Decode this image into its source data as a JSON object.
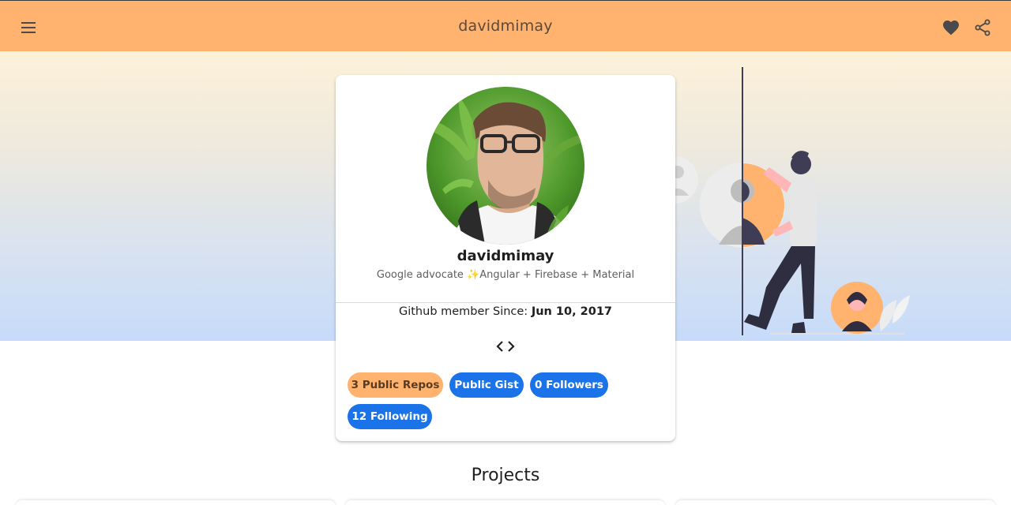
{
  "toolbar": {
    "title": "davidmimay",
    "menu_icon": "menu-icon",
    "favorite_icon": "heart-icon",
    "share_icon": "share-icon"
  },
  "profile": {
    "username": "davidmimay",
    "bio": "Google advocate ✨Angular + Firebase + Material",
    "member_label": "Github member Since: ",
    "member_date": "Jun 10, 2017",
    "code_icon": "code-icon"
  },
  "chips": {
    "repos": "3 Public Repos",
    "gist": "Public Gist",
    "followers": "0 Followers",
    "following": "12 Following"
  },
  "projects": {
    "title": "Projects"
  },
  "colors": {
    "toolbar": "#ffb36f",
    "chip_accent": "#ffb36f",
    "chip_primary": "#1a73e8"
  }
}
